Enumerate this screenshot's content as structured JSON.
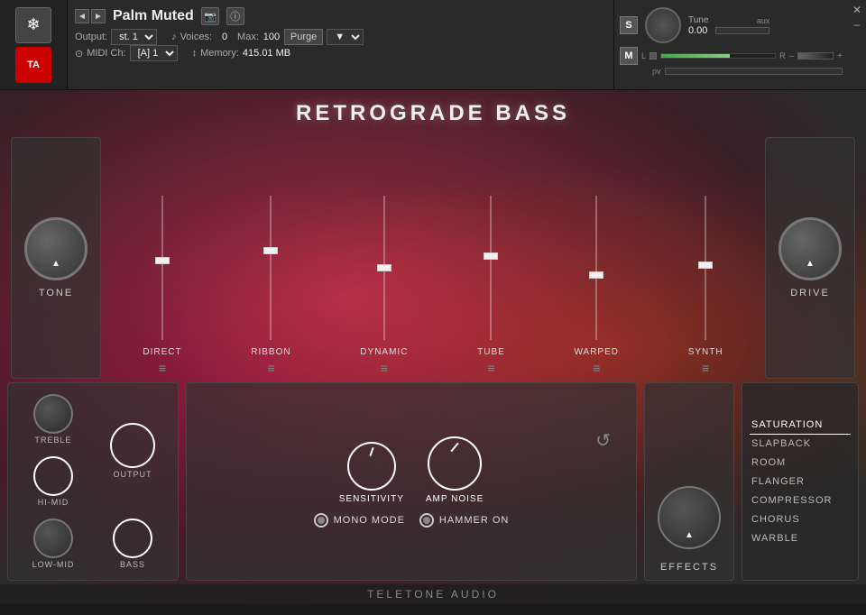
{
  "header": {
    "snowflake": "❄",
    "instrument_name": "Palm Muted",
    "nav_prev": "◄",
    "nav_next": "►",
    "camera": "📷",
    "info": "ⓘ",
    "s_btn": "S",
    "m_btn": "M",
    "output_label": "Output:",
    "output_value": "st. 1",
    "voices_label": "Voices:",
    "voices_value": "0",
    "max_label": "Max:",
    "max_value": "100",
    "purge_label": "Purge",
    "midi_label": "MIDI Ch:",
    "midi_value": "[A] 1",
    "memory_label": "Memory:",
    "memory_value": "415.01 MB",
    "tune_label": "Tune",
    "tune_value": "0.00",
    "level_left": "L",
    "level_right": "R",
    "plus": "+",
    "minus": "–",
    "aux": "aux",
    "pv": "pv",
    "ta_logo": "TA",
    "close": "✕"
  },
  "instrument": {
    "title": "RETROGRADE BASS",
    "tone_label": "TONE",
    "drive_label": "DRIVE",
    "sliders": [
      {
        "name": "DIRECT",
        "position": 45
      },
      {
        "name": "RIBBON",
        "position": 38
      },
      {
        "name": "DYNAMIC",
        "position": 50
      },
      {
        "name": "TUBE",
        "position": 42
      },
      {
        "name": "WARPED",
        "position": 55
      },
      {
        "name": "SYNTH",
        "position": 48
      }
    ],
    "eq": {
      "treble_label": "TREBLE",
      "hi_mid_label": "HI-MID",
      "output_label": "OUTPUT",
      "low_mid_label": "LOW-MID",
      "bass_label": "BASS"
    },
    "sensitivity_label": "SENSITIVITY",
    "amp_noise_label": "AMP NOISE",
    "reset_icon": "↺",
    "radio": {
      "mono_mode_label": "MONO MODE",
      "hammer_on_label": "HAMMER ON"
    },
    "effects_label": "EFFECTS",
    "fx_list": [
      {
        "name": "SATURATION",
        "active": true
      },
      {
        "name": "SLAPBACK",
        "active": false
      },
      {
        "name": "ROOM",
        "active": false
      },
      {
        "name": "FLANGER",
        "active": false
      },
      {
        "name": "COMPRESSOR",
        "active": false
      },
      {
        "name": "CHORUS",
        "active": false
      },
      {
        "name": "WARBLE",
        "active": false
      }
    ],
    "footer_label": "TELETONE AUDIO",
    "menu_icon": "≡"
  }
}
